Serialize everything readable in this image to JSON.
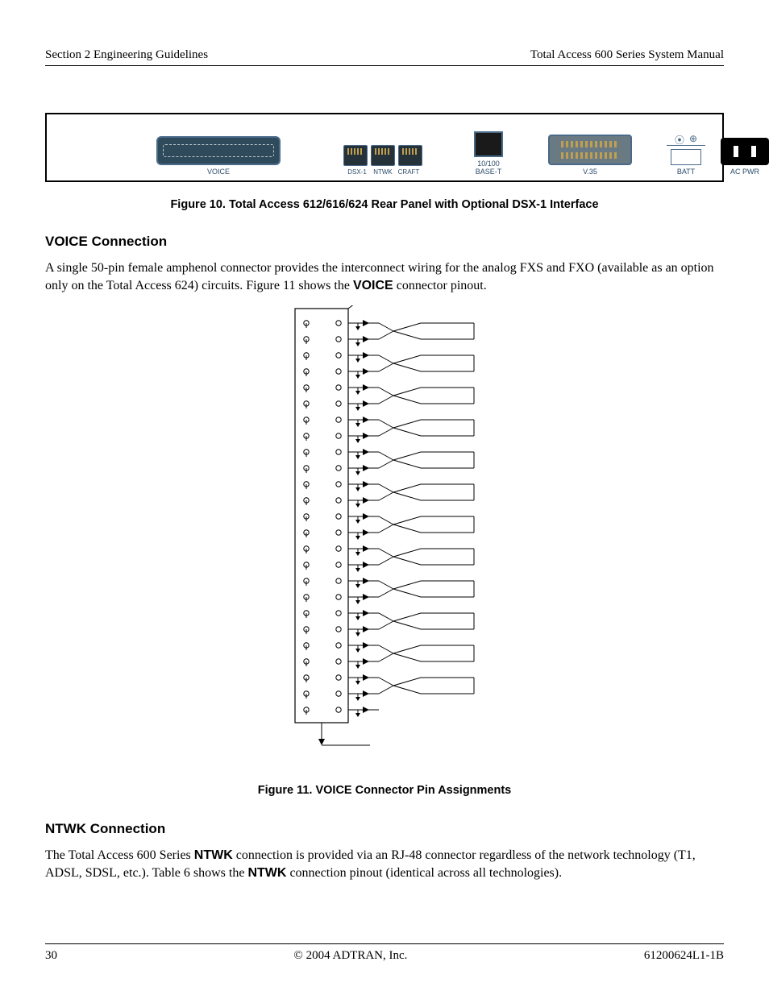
{
  "header": {
    "left": "Section 2  Engineering Guidelines",
    "right": "Total Access 600 Series System Manual"
  },
  "panel": {
    "voice_label": "VOICE",
    "rj_labels": [
      "DSX-1",
      "NTWK",
      "CRAFT"
    ],
    "eth_label": "10/100 BASE-T",
    "v35_label": "V.35",
    "batt_label": "BATT",
    "ac_label": "AC PWR"
  },
  "figure10_caption": "Figure 10.  Total Access 612/616/624 Rear Panel with Optional DSX-1 Interface",
  "section_voice_title": "VOICE Connection",
  "section_voice_body_pre": "A single 50-pin female amphenol connector provides the interconnect wiring for the analog FXS and FXO (available as an option only on the Total Access 624) circuits. Figure 11 shows the ",
  "section_voice_body_bold": "VOICE",
  "section_voice_body_post": " connector pinout.",
  "figure11_caption": "Figure 11.  VOICE Connector Pin Assignments",
  "section_ntwk_title": "NTWK Connection",
  "ntwk_body": {
    "pre": "The Total Access 600 Series ",
    "b1": "NTWK",
    "mid": " connection is provided via an RJ-48 connector regardless of the network technology (T1, ADSL, SDSL, etc.). Table 6 shows the ",
    "b2": "NTWK",
    "post": " connection pinout (identical across all technologies)."
  },
  "footer": {
    "left": "30",
    "center": "© 2004 ADTRAN, Inc.",
    "right": "61200624L1-1B"
  },
  "pinout": {
    "rows": 25
  }
}
